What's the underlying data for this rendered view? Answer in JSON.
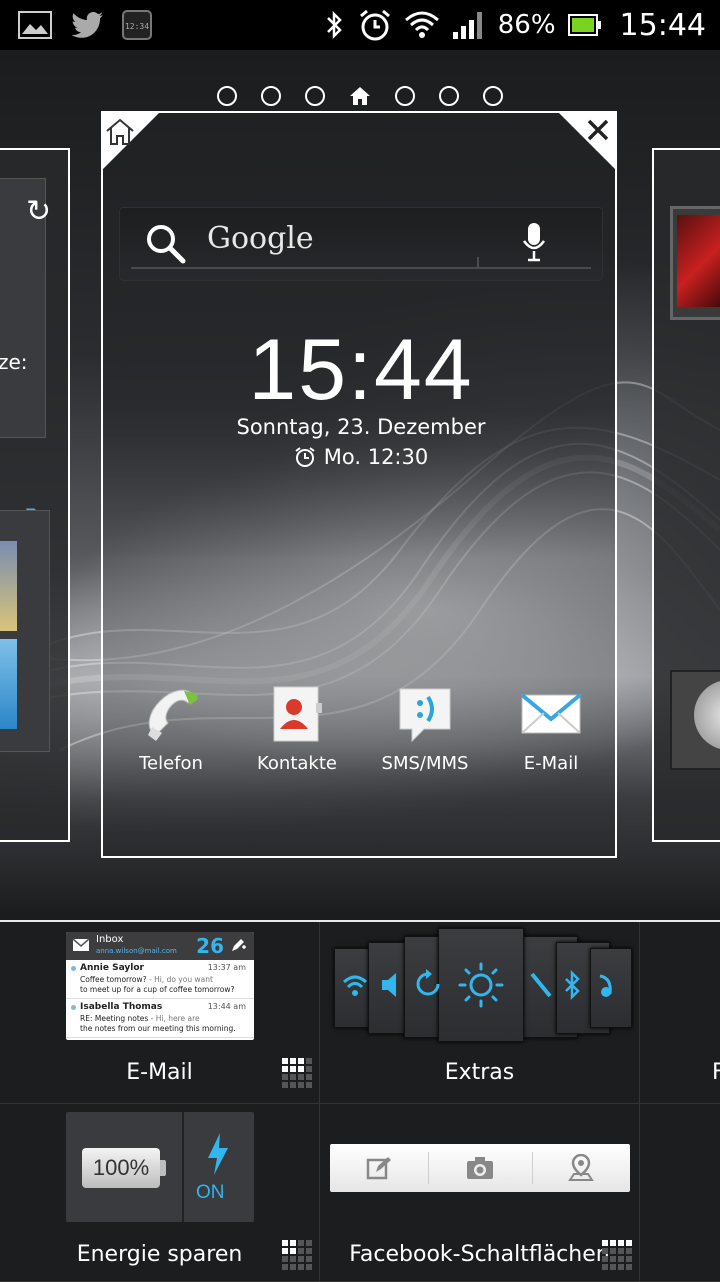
{
  "status_bar": {
    "battery_percent": "86%",
    "time": "15:44",
    "icons": [
      "gallery-icon",
      "twitter-icon",
      "clock-widget-icon",
      "bluetooth-icon",
      "alarm-icon",
      "wifi-icon",
      "signal-icon",
      "battery-icon"
    ]
  },
  "home": {
    "page_indicator": {
      "count": 7,
      "home_index": 3
    },
    "left_page_text": "ze:",
    "search": {
      "label": "Google"
    },
    "clock": {
      "time": "15:44",
      "date": "Sonntag, 23. Dezember",
      "alarm": "Mo. 12:30"
    },
    "apps": [
      {
        "label": "Telefon",
        "icon": "phone-icon"
      },
      {
        "label": "Kontakte",
        "icon": "contacts-icon"
      },
      {
        "label": "SMS/MMS",
        "icon": "sms-icon"
      },
      {
        "label": "E-Mail",
        "icon": "email-icon"
      }
    ]
  },
  "widgets": {
    "email": {
      "label": "E-Mail",
      "inbox": "Inbox",
      "address": "anna.wilson@mail.com",
      "count": "26",
      "messages": [
        {
          "from": "Annie Saylor",
          "time": "13:37 am",
          "subject": "Coffee tomorrow?",
          "preview1": " - Hi, do you want",
          "preview2": "to meet up for a cup of coffee tomorrow?"
        },
        {
          "from": "Isabella Thomas",
          "time": "13:44 am",
          "subject": "RE: Meeting notes",
          "preview1": " - Hi, here are",
          "preview2": "the notes from our meeting this morning."
        }
      ]
    },
    "extras": {
      "label": "Extras"
    },
    "energy": {
      "label": "Energie sparen",
      "battery": "100%",
      "state": "ON"
    },
    "facebook": {
      "label": "Facebook-Schaltflächen"
    },
    "partial_right": {
      "label": "F"
    }
  },
  "colors": {
    "accent": "#31b6ee",
    "tray_bg": "#1c1d1f",
    "statusbar_bg": "#000000"
  }
}
